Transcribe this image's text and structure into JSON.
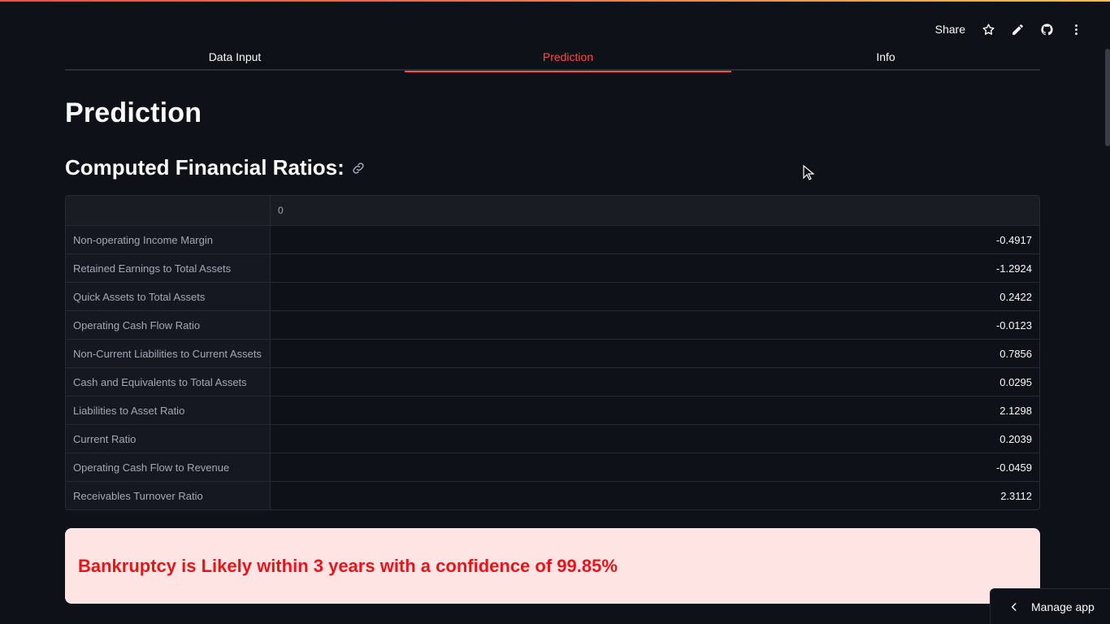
{
  "header": {
    "share_label": "Share",
    "icons": [
      "star-icon",
      "pencil-icon",
      "github-icon",
      "more-vertical-icon"
    ]
  },
  "tabs": [
    {
      "label": "Data Input",
      "active": false
    },
    {
      "label": "Prediction",
      "active": true
    },
    {
      "label": "Info",
      "active": false
    }
  ],
  "page_title": "Prediction",
  "section_heading": "Computed Financial Ratios:",
  "table": {
    "column_header": "0",
    "rows": [
      {
        "label": "Non-operating Income Margin",
        "value": "-0.4917"
      },
      {
        "label": "Retained Earnings to Total Assets",
        "value": "-1.2924"
      },
      {
        "label": "Quick Assets to Total Assets",
        "value": "0.2422"
      },
      {
        "label": "Operating Cash Flow Ratio",
        "value": "-0.0123"
      },
      {
        "label": "Non-Current Liabilities to Current Assets",
        "value": "0.7856"
      },
      {
        "label": "Cash and Equivalents to Total Assets",
        "value": "0.0295"
      },
      {
        "label": "Liabilities to Asset Ratio",
        "value": "2.1298"
      },
      {
        "label": "Current Ratio",
        "value": "0.2039"
      },
      {
        "label": "Operating Cash Flow to Revenue",
        "value": "-0.0459"
      },
      {
        "label": "Receivables Turnover Ratio",
        "value": "2.3112"
      }
    ]
  },
  "alert": {
    "text": "Bankruptcy is Likely within 3 years with a confidence of 99.85%"
  },
  "manage_app_label": "Manage app",
  "colors": {
    "background": "#0e1117",
    "accent": "#ff4b4b",
    "alert_bg": "#ffe4e4",
    "alert_text": "#e8141a"
  }
}
